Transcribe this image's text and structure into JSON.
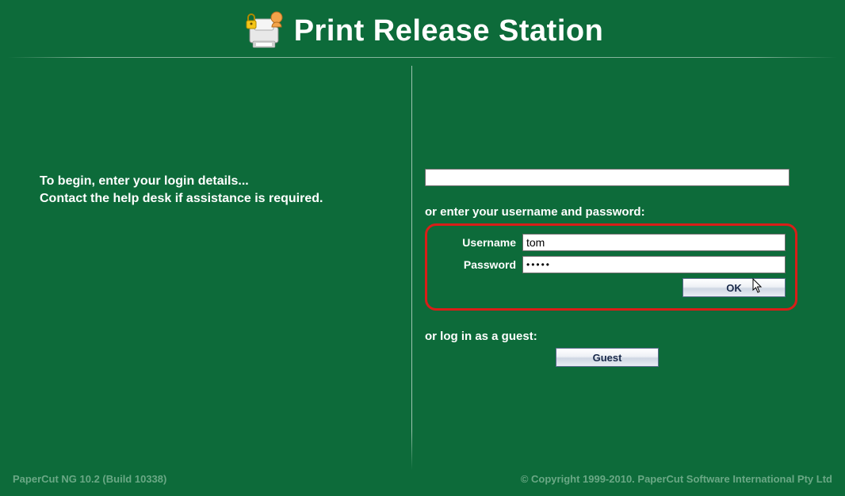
{
  "header": {
    "title": "Print Release Station"
  },
  "left": {
    "line1": "To begin, enter your login details...",
    "line2": "Contact the help desk if assistance is required."
  },
  "right": {
    "card_value": "",
    "creds_section_label": "or enter your username and password:",
    "username_label": "Username",
    "username_value": "tom",
    "password_label": "Password",
    "password_value": "•••••",
    "ok_label": "OK",
    "guest_section_label": "or log in as a guest:",
    "guest_label": "Guest"
  },
  "footer": {
    "version": "PaperCut NG 10.2 (Build 10338)",
    "copyright": "© Copyright 1999-2010. PaperCut Software International Pty Ltd"
  }
}
